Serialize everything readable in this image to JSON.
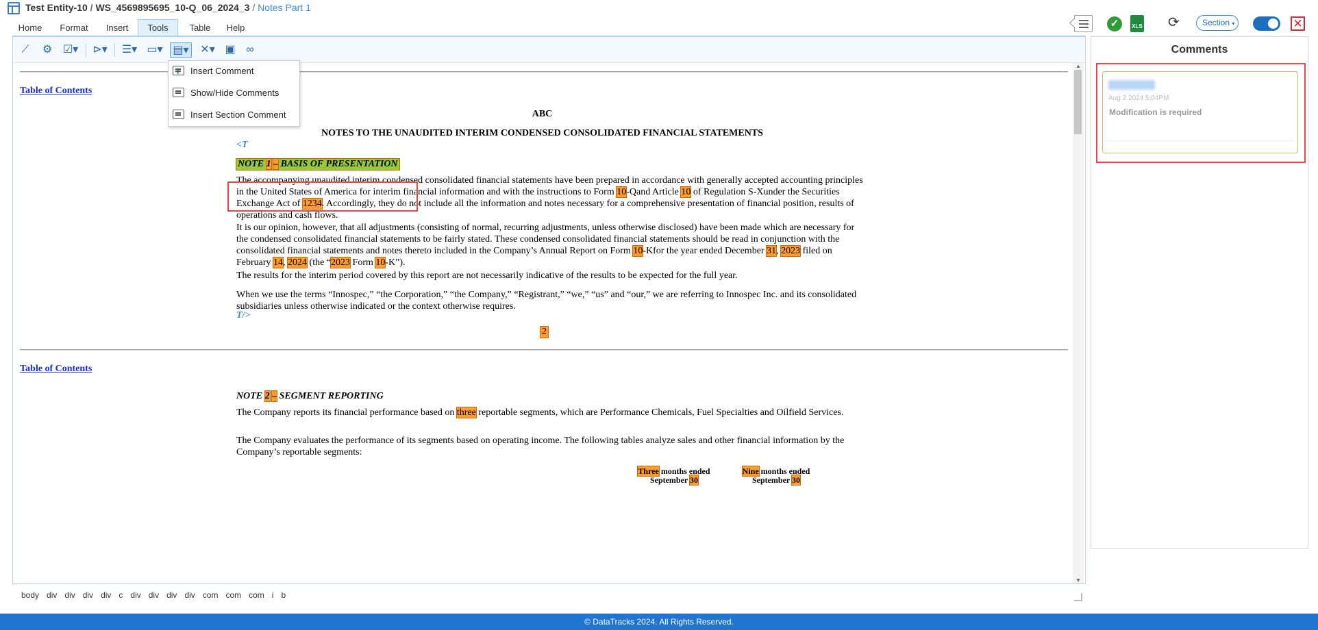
{
  "header": {
    "entity": "Test Entity-10",
    "workspace": "WS_4569895695_10-Q_06_2024_3",
    "separator": "/",
    "notes": "Notes Part 1"
  },
  "menu": [
    "Home",
    "Format",
    "Insert",
    "Tools",
    "Table",
    "Help"
  ],
  "menu_active": "Tools",
  "top_controls": {
    "section_label": "Section",
    "xls_label": "XLS"
  },
  "dropdown": {
    "insert_comment": "Insert Comment",
    "show_hide_comments": "Show/Hide Comments",
    "insert_section_comment": "Insert Section Comment"
  },
  "doc": {
    "toc": "Table of Contents",
    "company": "ABC",
    "heading": "NOTES TO THE UNAUDITED INTERIM CONDENSED CONSOLIDATED FINANCIAL STATEMENTS",
    "tag_open": "<T",
    "tag_close": "T/>",
    "note1": {
      "prefix": "NOTE ",
      "num": "1",
      "dash": "–",
      "title": " BASIS OF PRESENTATION"
    },
    "p1": [
      "The accompanying unaudited interim condensed consolidated financial statements have been prepared in accordance with generally accepted accounting principles in the United States of America for interim financial information and with the instructions to Form ",
      "10",
      "-Qand Article ",
      "10",
      " of Regulation S-Xunder the Securities Exchange Act of ",
      "1234",
      ". Accordingly, they do not include all the information and notes necessary for a comprehensive presentation of financial position, results of operations and cash flows."
    ],
    "p2": [
      "It is our opinion, however, that all adjustments (consisting of normal, recurring adjustments, unless otherwise disclosed) have been made which are necessary for the condensed consolidated financial statements to be fairly stated. These condensed consolidated financial statements should be read in conjunction with the consolidated financial statements and notes thereto included in the Company’s Annual Report on Form ",
      "10",
      "-Kfor the year ended December ",
      "31",
      ", ",
      "2023",
      " filed on February ",
      "14",
      ", ",
      "2024",
      " (the “",
      "2023",
      " Form ",
      "10",
      "-K”)."
    ],
    "p3": "The results for the interim period covered by this report are not necessarily indicative of the results to be expected for the full year.",
    "p4": "When we use the terms “Innospec,” “the Corporation,” “the Company,” “Registrant,” “we,” “us” and “our,” we are referring to Innospec Inc. and its consolidated subsidiaries unless otherwise indicated or the context otherwise requires.",
    "page_number": "2",
    "note2": {
      "prefix": "NOTE ",
      "num": "2",
      "dash": "–",
      "title": " SEGMENT REPORTING"
    },
    "p5": [
      "The Company reports its financial performance based on ",
      "three",
      " reportable segments, which are Performance Chemicals, Fuel Specialties and Oilfield Services."
    ],
    "p6": "The Company evaluates the performance of its segments based on operating income. The following tables analyze sales and other financial information by the Company’s reportable segments:",
    "table_head": {
      "col1": {
        "hl": "Three",
        "rest": " months ended",
        "line2": "September ",
        "day": "30"
      },
      "col2": {
        "hl": "Nine",
        "rest": " months ended",
        "line2": "September ",
        "day": "30"
      }
    }
  },
  "comments": {
    "title": "Comments",
    "card": {
      "date": "Aug 2 2024 5:04PM",
      "text": "Modification is required"
    }
  },
  "path": [
    "body",
    "div",
    "div",
    "div",
    "div",
    "c",
    "div",
    "div",
    "div",
    "div",
    "com",
    "com",
    "com",
    "i",
    "b"
  ],
  "footer": "© DataTracks 2024. All Rights Reserved."
}
